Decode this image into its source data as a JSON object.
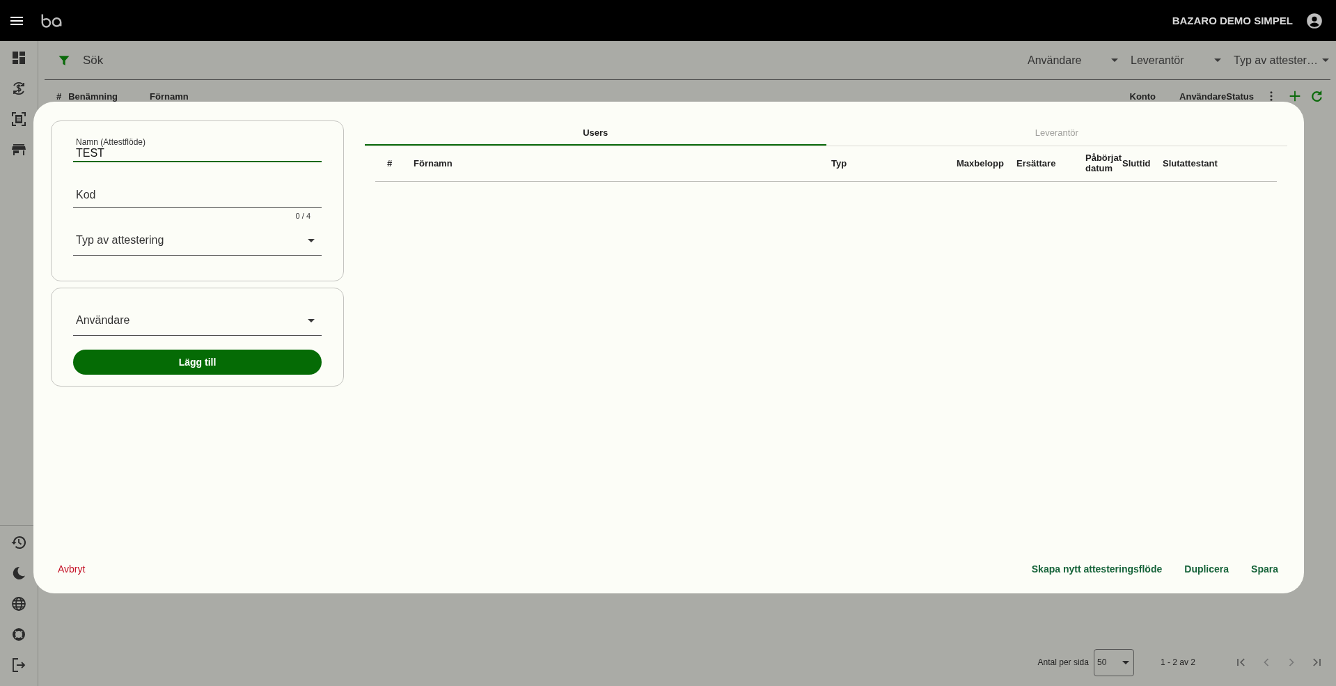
{
  "top_bar": {
    "title": "BAZARO DEMO SIMPEL"
  },
  "filter_bar": {
    "search": {
      "placeholder": "Sök"
    },
    "dropdowns": [
      {
        "label": "Användare"
      },
      {
        "label": "Leverantör"
      },
      {
        "label": "Typ av attester…"
      }
    ]
  },
  "list_table": {
    "columns_left": [
      "#",
      "Benämning",
      "Förnamn"
    ],
    "columns_right": [
      "Konto",
      "Användare",
      "Status"
    ]
  },
  "pagination": {
    "label": "Antal per sida",
    "page_size": "50",
    "range": "1 - 2 av 2"
  },
  "dialog": {
    "name_field": {
      "label": "Namn (Attestflöde)",
      "value": "TEST"
    },
    "code_field": {
      "placeholder": "Kod",
      "counter": "0 / 4"
    },
    "type_select": {
      "placeholder": "Typ av attestering"
    },
    "user_select": {
      "placeholder": "Användare"
    },
    "add_button": "Lägg till",
    "tabs": [
      {
        "label": "Users",
        "selected": true
      },
      {
        "label": "Leverantör",
        "selected": false
      }
    ],
    "table": {
      "columns": [
        "#",
        "Förnamn",
        "Typ",
        "Maxbelopp",
        "Ersättare",
        "Påbörjat datum",
        "Sluttid",
        "Slutattestant"
      ]
    },
    "cancel_button": "Avbryt",
    "actions": [
      "Skapa nytt attesteringsflöde",
      "Duplicera",
      "Spara"
    ]
  }
}
